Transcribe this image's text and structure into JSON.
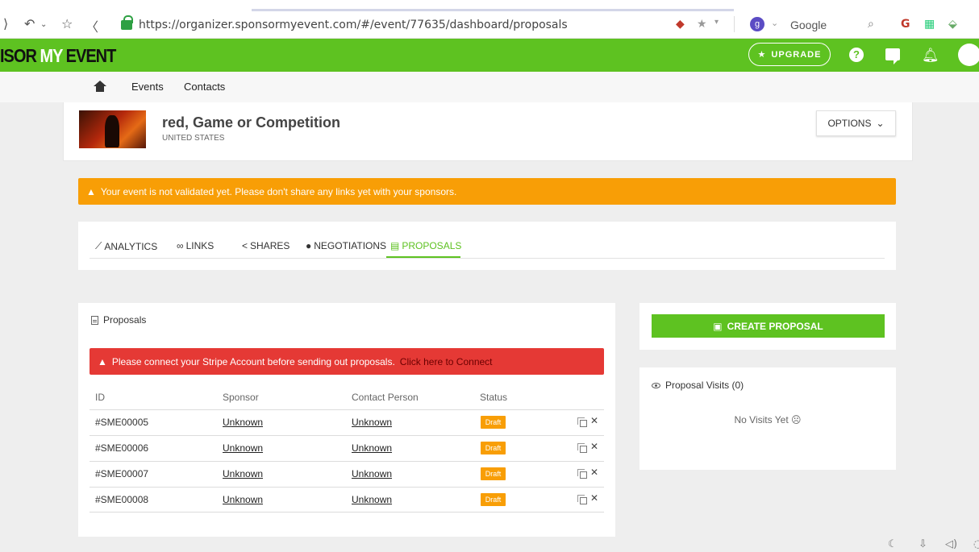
{
  "browser": {
    "url": "https://organizer.sponsormyevent.com/#/event/77635/dashboard/proposals",
    "search_engine": "Google"
  },
  "header": {
    "logo_prefix": "ISOR ",
    "logo_my": "MY",
    "logo_suffix": " EVENT",
    "upgrade_label": "UPGRADE",
    "accent_color": "#5ec221"
  },
  "nav": {
    "events": "Events",
    "contacts": "Contacts"
  },
  "event": {
    "title": "red, Game or Competition",
    "country": "UNITED STATES",
    "options_label": "OPTIONS"
  },
  "warning": {
    "text": "Your event is not validated yet. Please don't share any links yet with your sponsors."
  },
  "tabs": [
    {
      "label": "ANALYTICS",
      "icon": "chart-icon"
    },
    {
      "label": "LINKS",
      "icon": "link-icon"
    },
    {
      "label": "SHARES",
      "icon": "share-icon"
    },
    {
      "label": "NEGOTIATIONS",
      "icon": "chat-icon"
    },
    {
      "label": "PROPOSALS",
      "icon": "document-icon",
      "active": true
    }
  ],
  "proposals": {
    "title": "Proposals",
    "stripe_warning": "Please connect your Stripe Account before sending out proposals.",
    "stripe_link": "Click here to Connect",
    "columns": [
      "ID",
      "Sponsor",
      "Contact Person",
      "Status"
    ],
    "rows": [
      {
        "id": "#SME00005",
        "sponsor": "Unknown",
        "contact": "Unknown",
        "status": "Draft"
      },
      {
        "id": "#SME00006",
        "sponsor": "Unknown",
        "contact": "Unknown",
        "status": "Draft"
      },
      {
        "id": "#SME00007",
        "sponsor": "Unknown",
        "contact": "Unknown",
        "status": "Draft"
      },
      {
        "id": "#SME00008",
        "sponsor": "Unknown",
        "contact": "Unknown",
        "status": "Draft"
      }
    ]
  },
  "sidebar": {
    "create_label": "CREATE PROPOSAL",
    "visits_title": "Proposal Visits (0)",
    "no_visits": "No Visits Yet ☹"
  }
}
